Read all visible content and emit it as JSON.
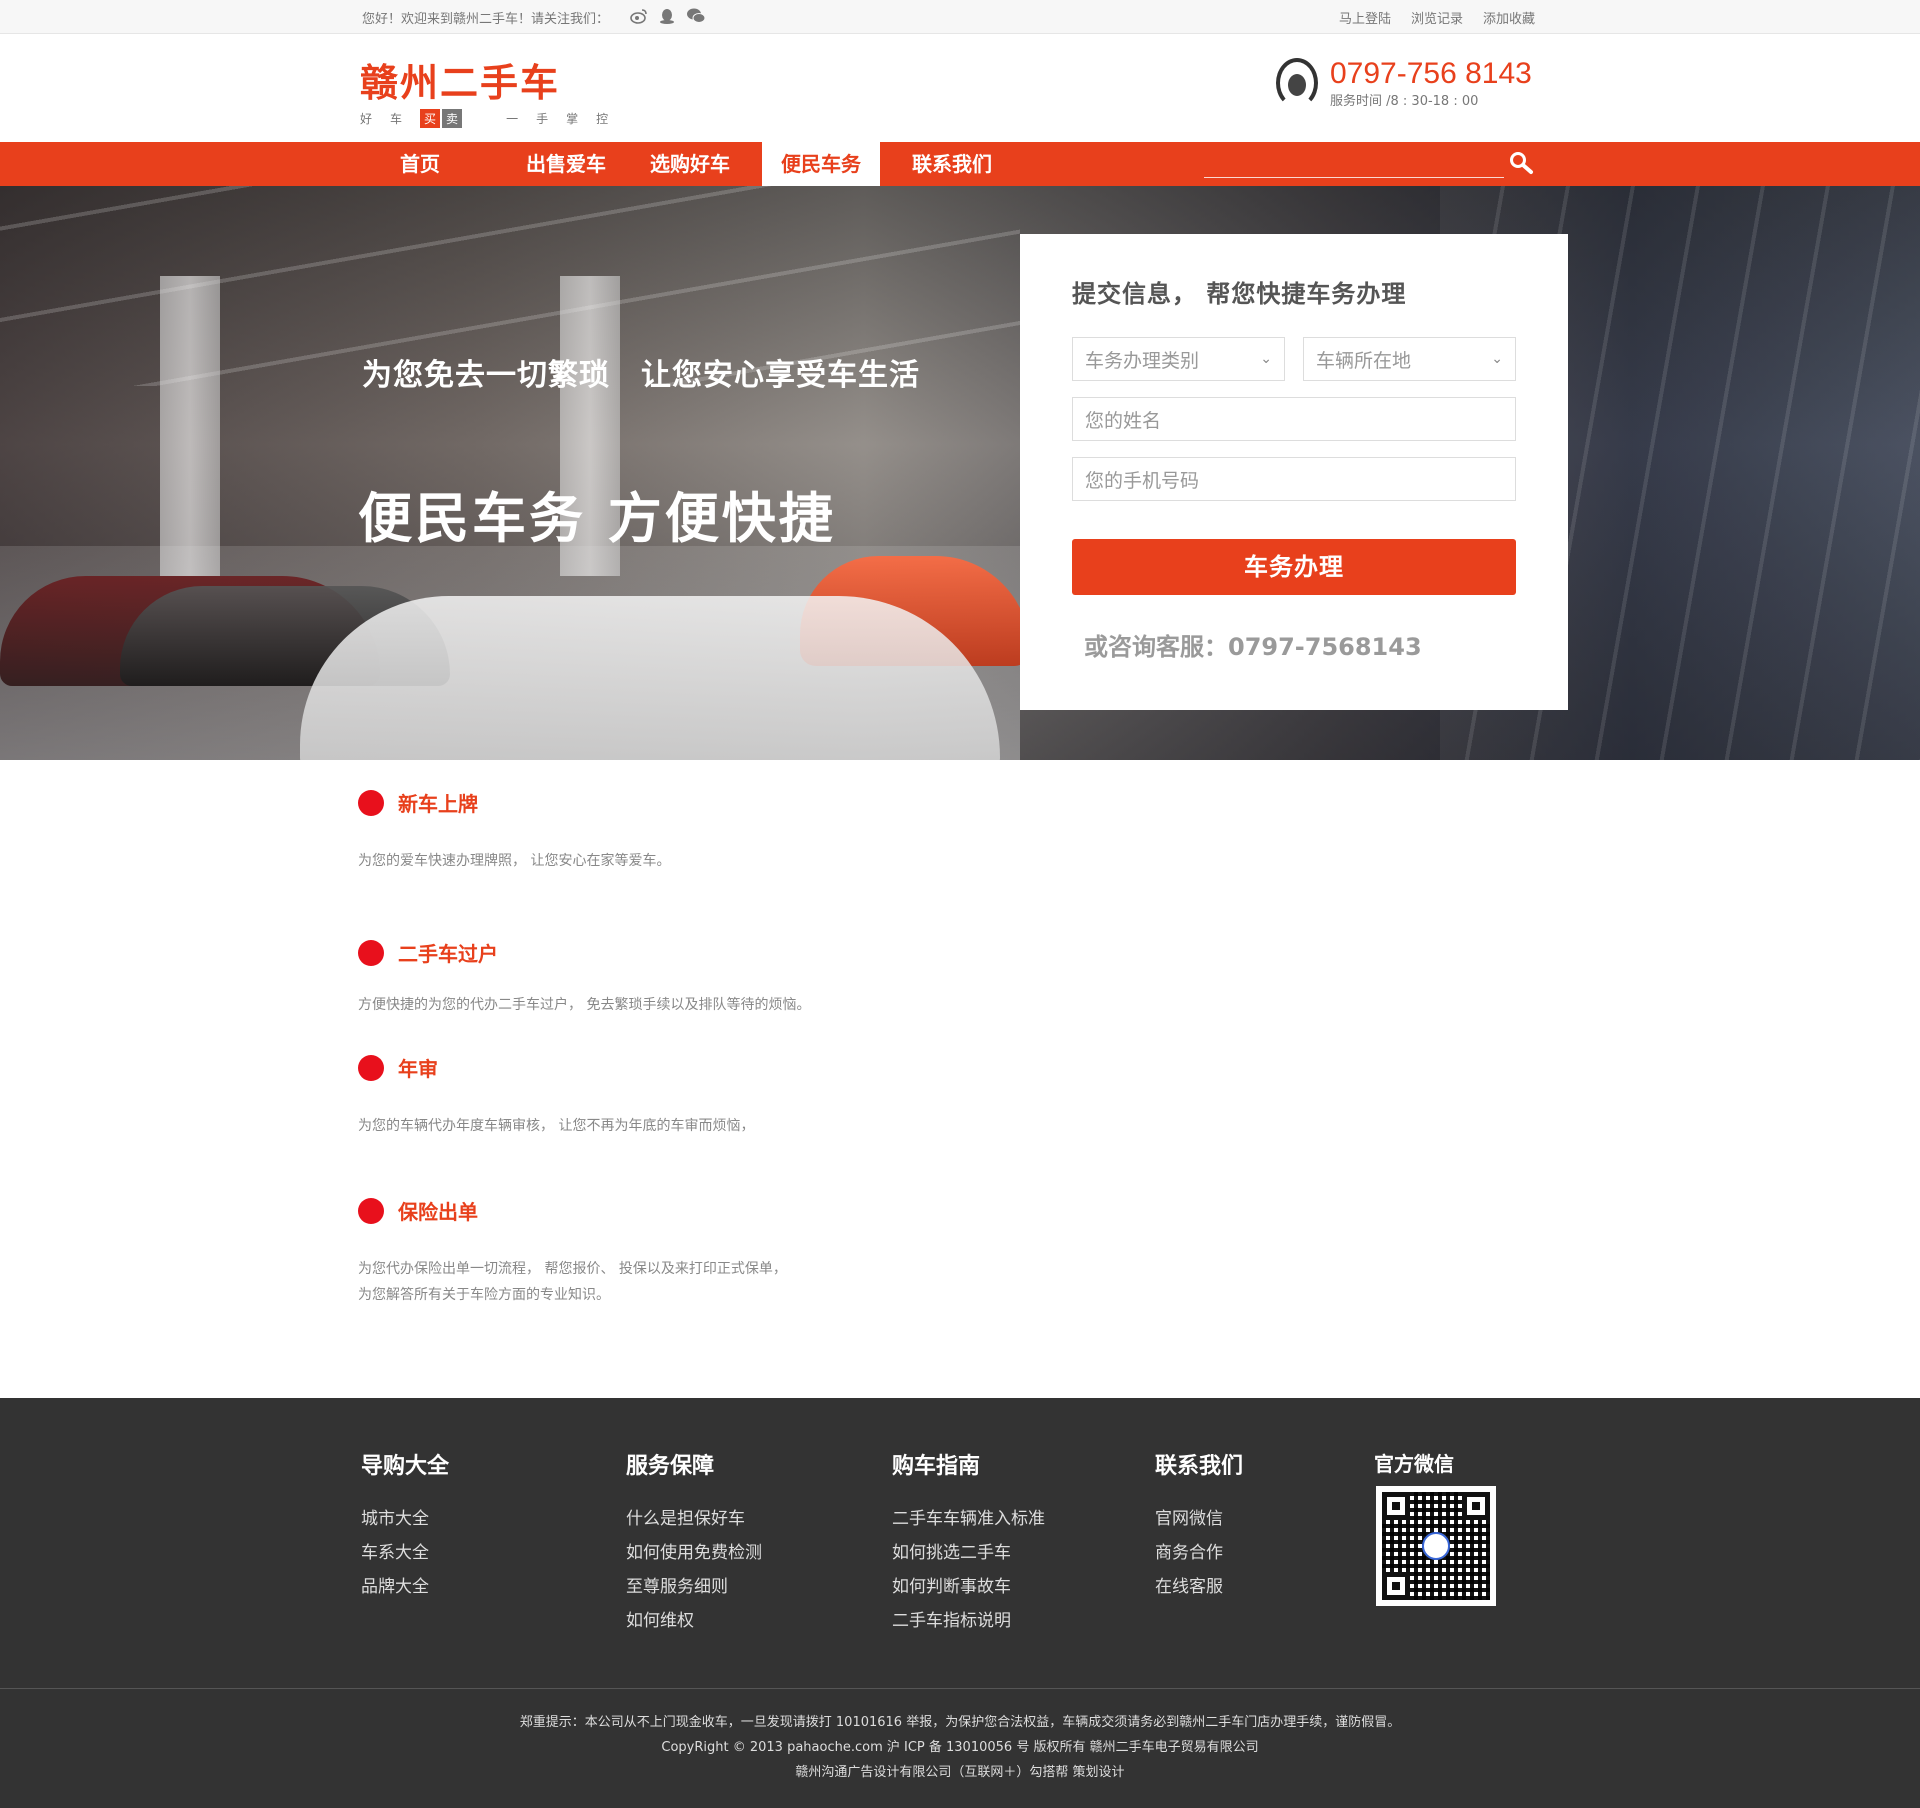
{
  "topbar": {
    "welcome": "您好！欢迎来到赣州二手车！请关注我们：",
    "social_icons": [
      "weibo-icon",
      "qq-icon",
      "wechat-icon"
    ],
    "links": [
      "马上登陆",
      "浏览记录",
      "添加收藏"
    ]
  },
  "header": {
    "brand": "赣州二手车",
    "slogan_left": [
      "好",
      "车"
    ],
    "slogan_buy": "买",
    "slogan_sell": "卖",
    "slogan_right": [
      "一",
      "手",
      "掌",
      "控"
    ],
    "phone": "0797-756 8143",
    "service_time": "服务时间 /8 : 30-18 : 00"
  },
  "nav": {
    "items": [
      "首页",
      "出售爱车",
      "选购好车",
      "便民车务",
      "联系我们"
    ],
    "active": "便民车务",
    "search_placeholder": ""
  },
  "hero": {
    "line1": "为您免去一切繁琐　让您安心享受车生活",
    "line2": "便民车务  方便快捷"
  },
  "form": {
    "title": "提交信息，  帮您快捷车务办理",
    "select_type": "车务办理类别",
    "select_location": "车辆所在地",
    "name_placeholder": "您的姓名",
    "phone_placeholder": "您的手机号码",
    "submit": "车务办理",
    "consult": "或咨询客服：0797-7568143"
  },
  "services": [
    {
      "name": "新车上牌",
      "desc": [
        "为您的爱车快速办理牌照，  让您安心在家等爱车。"
      ]
    },
    {
      "name": "二手车过户",
      "desc": [
        "方便快捷的为您的代办二手车过户，  免去繁琐手续以及排队等待的烦恼。"
      ]
    },
    {
      "name": "年审",
      "desc": [
        "为您的车辆代办年度车辆审核，  让您不再为年底的车审而烦恼，"
      ]
    },
    {
      "name": "保险出单",
      "desc": [
        "为您代办保险出单一切流程，  帮您报价、  投保以及来打印正式保单，",
        "为您解答所有关于车险方面的专业知识。"
      ]
    }
  ],
  "footer": {
    "columns": [
      {
        "title": "导购大全",
        "items": [
          "城市大全",
          "车系大全",
          "品牌大全"
        ]
      },
      {
        "title": "服务保障",
        "items": [
          "什么是担保好车",
          "如何使用免费检测",
          "至尊服务细则",
          "如何维权"
        ]
      },
      {
        "title": "购车指南",
        "items": [
          "二手车车辆准入标准",
          "如何挑选二手车",
          "如何判断事故车",
          "二手车指标说明"
        ]
      },
      {
        "title": "联系我们",
        "items": [
          "官网微信",
          "商务合作",
          "在线客服"
        ]
      }
    ],
    "wechat_title": "官方微信",
    "legal": [
      "郑重提示：本公司从不上门现金收车，一旦发现请拨打 10101616 举报，为保护您合法权益，车辆成交须请务必到赣州二手车门店办理手续，谨防假冒。",
      "CopyRight © 2013 pahaoche.com 沪 ICP 备 13010056 号 版权所有 赣州二手车电子贸易有限公司",
      "赣州沟通广告设计有限公司（互联网＋）勾搭帮 策划设计"
    ]
  },
  "colors": {
    "accent": "#e8401c",
    "footer_bg": "#333333",
    "dot": "#e8101c"
  }
}
